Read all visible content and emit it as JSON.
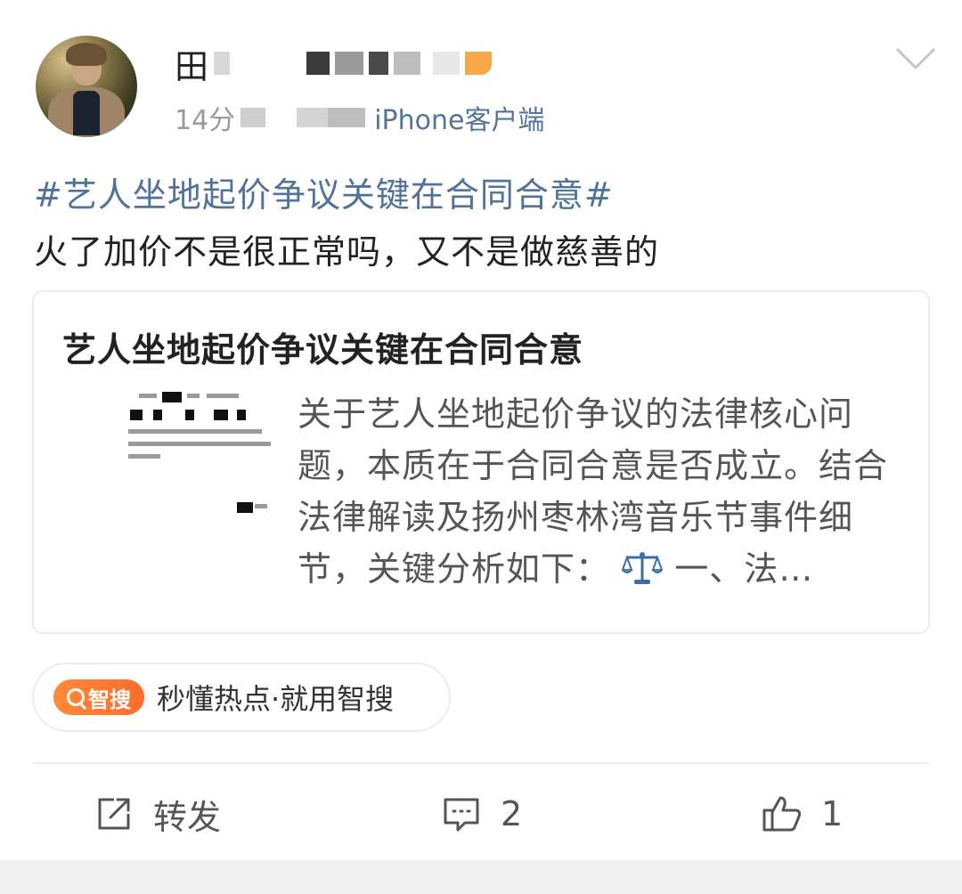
{
  "header": {
    "username_visible": "田",
    "time_prefix": "14分",
    "source": "iPhone客户端"
  },
  "post": {
    "topic": "#艺人坐地起价争议关键在合同合意#",
    "text": "火了加价不是很正常吗，又不是做慈善的"
  },
  "card": {
    "title": "艺人坐地起价争议关键在合同合意",
    "description_before_icon": "关于艺人坐地起价争议的法律核心问题，本质在于合同合意是否成立。结合法律解读及扬州枣林湾音乐节事件细节，关键分析如下：",
    "description_after_icon": "一、法…",
    "icon": "scales-icon"
  },
  "promo": {
    "badge": "智搜",
    "text": "秒懂热点·就用智搜"
  },
  "actions": {
    "repost_label": "转发",
    "comment_count": "2",
    "like_count": "1"
  },
  "colors": {
    "topic": "#50729b",
    "source": "#55739a",
    "promo_badge": "#ff7a30"
  }
}
